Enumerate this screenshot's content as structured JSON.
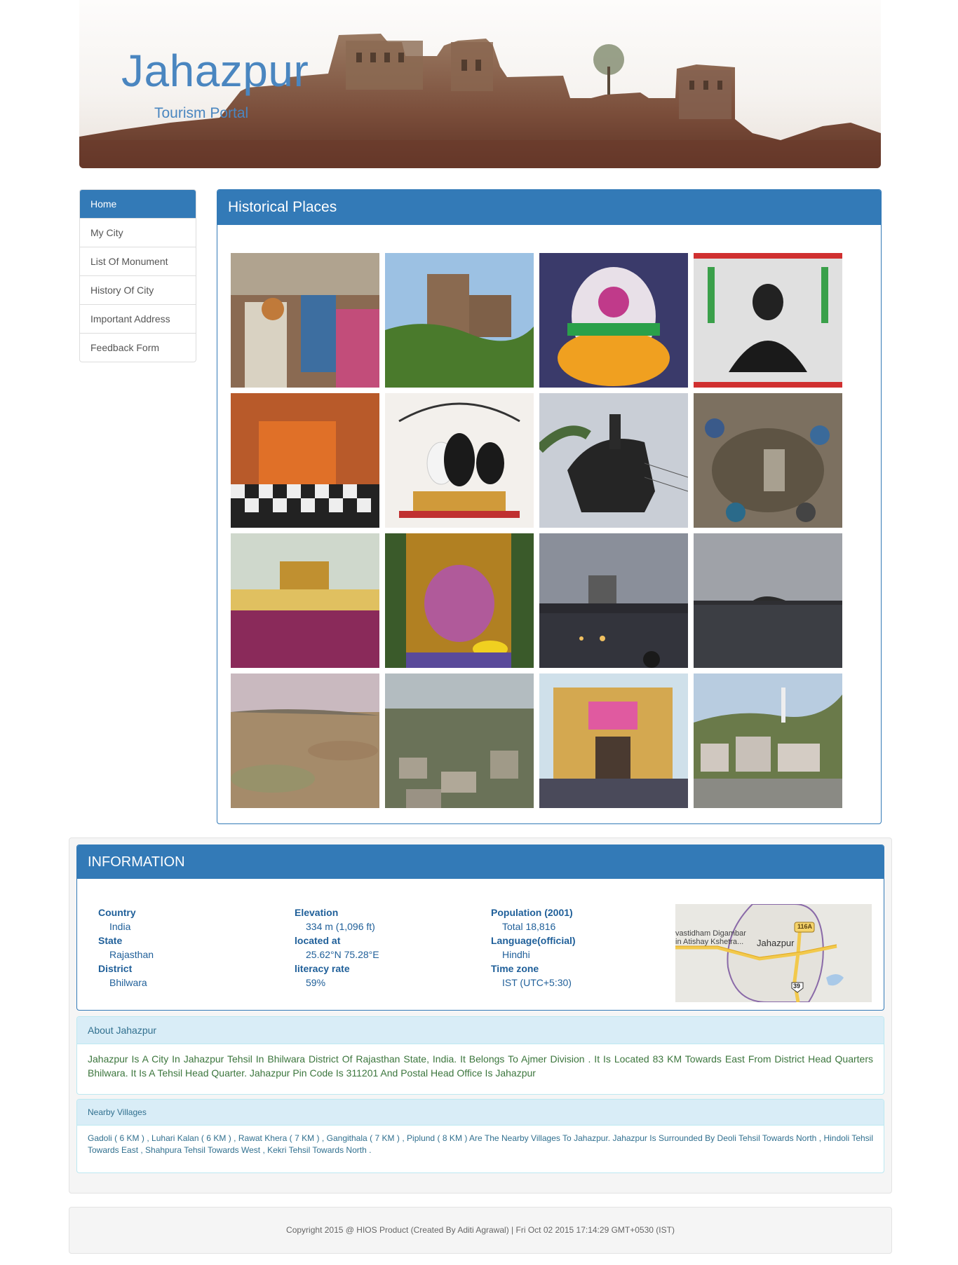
{
  "header": {
    "title": "Jahazpur",
    "subtitle": "Tourism Portal"
  },
  "nav": {
    "items": [
      "Home",
      "My City",
      "List Of Monument",
      "History Of City",
      "Important Address",
      "Feedback Form"
    ]
  },
  "gallery": {
    "heading": "Historical Places"
  },
  "info": {
    "heading": "INFORMATION",
    "col1": [
      {
        "label": "Country",
        "value": "India"
      },
      {
        "label": "State",
        "value": "Rajasthan"
      },
      {
        "label": "District",
        "value": "Bhilwara"
      }
    ],
    "col2": [
      {
        "label": "Elevation",
        "value": "334 m (1,096 ft)"
      },
      {
        "label": "located at",
        "value": "25.62°N 75.28°E"
      },
      {
        "label": "literacy rate",
        "value": "59%"
      }
    ],
    "col3": [
      {
        "label": "Population (2001)",
        "value": "Total 18,816"
      },
      {
        "label": "Language(official)",
        "value": "Hindhi"
      },
      {
        "label": "Time zone",
        "value": "IST (UTC+5:30)"
      }
    ],
    "map": {
      "place_line1": "vastidham Digambar",
      "place_line2": "in Atishay Kshetra...",
      "town": "Jahazpur",
      "shield_top": "116A",
      "shield_bottom": "39"
    }
  },
  "about": {
    "heading": "About Jahazpur",
    "text": "Jahazpur Is A City In Jahazpur Tehsil In Bhilwara District Of Rajasthan State, India. It Belongs To Ajmer Division . It Is Located 83 KM Towards East From District Head Quarters Bhilwara. It Is A Tehsil Head Quarter. Jahazpur Pin Code Is 311201 And Postal Head Office Is Jahazpur"
  },
  "nearby": {
    "heading": "Nearby Villages",
    "text": "Gadoli ( 6 KM ) , Luhari Kalan ( 6 KM ) , Rawat Khera ( 7 KM ) , Gangithala ( 7 KM ) , Piplund ( 8 KM ) Are The Nearby Villages To Jahazpur. Jahazpur Is Surrounded By Deoli Tehsil Towards North , Hindoli Tehsil Towards East , Shahpura Tehsil Towards West , Kekri Tehsil Towards North ."
  },
  "footer": {
    "text": "Copyright 2015 @ HIOS Product (Created By Aditi Agrawal) | Fri Oct 02 2015 17:14:29 GMT+0530 (IST)"
  }
}
